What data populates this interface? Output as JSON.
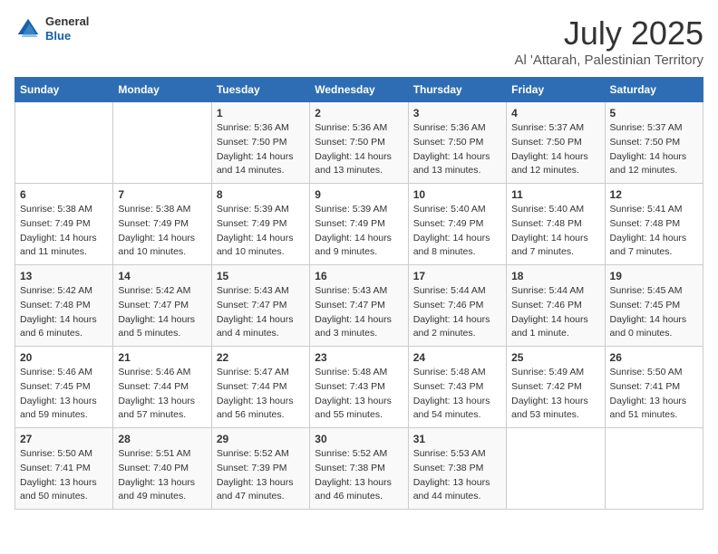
{
  "logo": {
    "general": "General",
    "blue": "Blue"
  },
  "title": "July 2025",
  "subtitle": "Al 'Attarah, Palestinian Territory",
  "weekdays": [
    "Sunday",
    "Monday",
    "Tuesday",
    "Wednesday",
    "Thursday",
    "Friday",
    "Saturday"
  ],
  "weeks": [
    [
      {
        "day": "",
        "info": ""
      },
      {
        "day": "",
        "info": ""
      },
      {
        "day": "1",
        "info": "Sunrise: 5:36 AM\nSunset: 7:50 PM\nDaylight: 14 hours\nand 14 minutes."
      },
      {
        "day": "2",
        "info": "Sunrise: 5:36 AM\nSunset: 7:50 PM\nDaylight: 14 hours\nand 13 minutes."
      },
      {
        "day": "3",
        "info": "Sunrise: 5:36 AM\nSunset: 7:50 PM\nDaylight: 14 hours\nand 13 minutes."
      },
      {
        "day": "4",
        "info": "Sunrise: 5:37 AM\nSunset: 7:50 PM\nDaylight: 14 hours\nand 12 minutes."
      },
      {
        "day": "5",
        "info": "Sunrise: 5:37 AM\nSunset: 7:50 PM\nDaylight: 14 hours\nand 12 minutes."
      }
    ],
    [
      {
        "day": "6",
        "info": "Sunrise: 5:38 AM\nSunset: 7:49 PM\nDaylight: 14 hours\nand 11 minutes."
      },
      {
        "day": "7",
        "info": "Sunrise: 5:38 AM\nSunset: 7:49 PM\nDaylight: 14 hours\nand 10 minutes."
      },
      {
        "day": "8",
        "info": "Sunrise: 5:39 AM\nSunset: 7:49 PM\nDaylight: 14 hours\nand 10 minutes."
      },
      {
        "day": "9",
        "info": "Sunrise: 5:39 AM\nSunset: 7:49 PM\nDaylight: 14 hours\nand 9 minutes."
      },
      {
        "day": "10",
        "info": "Sunrise: 5:40 AM\nSunset: 7:49 PM\nDaylight: 14 hours\nand 8 minutes."
      },
      {
        "day": "11",
        "info": "Sunrise: 5:40 AM\nSunset: 7:48 PM\nDaylight: 14 hours\nand 7 minutes."
      },
      {
        "day": "12",
        "info": "Sunrise: 5:41 AM\nSunset: 7:48 PM\nDaylight: 14 hours\nand 7 minutes."
      }
    ],
    [
      {
        "day": "13",
        "info": "Sunrise: 5:42 AM\nSunset: 7:48 PM\nDaylight: 14 hours\nand 6 minutes."
      },
      {
        "day": "14",
        "info": "Sunrise: 5:42 AM\nSunset: 7:47 PM\nDaylight: 14 hours\nand 5 minutes."
      },
      {
        "day": "15",
        "info": "Sunrise: 5:43 AM\nSunset: 7:47 PM\nDaylight: 14 hours\nand 4 minutes."
      },
      {
        "day": "16",
        "info": "Sunrise: 5:43 AM\nSunset: 7:47 PM\nDaylight: 14 hours\nand 3 minutes."
      },
      {
        "day": "17",
        "info": "Sunrise: 5:44 AM\nSunset: 7:46 PM\nDaylight: 14 hours\nand 2 minutes."
      },
      {
        "day": "18",
        "info": "Sunrise: 5:44 AM\nSunset: 7:46 PM\nDaylight: 14 hours\nand 1 minute."
      },
      {
        "day": "19",
        "info": "Sunrise: 5:45 AM\nSunset: 7:45 PM\nDaylight: 14 hours\nand 0 minutes."
      }
    ],
    [
      {
        "day": "20",
        "info": "Sunrise: 5:46 AM\nSunset: 7:45 PM\nDaylight: 13 hours\nand 59 minutes."
      },
      {
        "day": "21",
        "info": "Sunrise: 5:46 AM\nSunset: 7:44 PM\nDaylight: 13 hours\nand 57 minutes."
      },
      {
        "day": "22",
        "info": "Sunrise: 5:47 AM\nSunset: 7:44 PM\nDaylight: 13 hours\nand 56 minutes."
      },
      {
        "day": "23",
        "info": "Sunrise: 5:48 AM\nSunset: 7:43 PM\nDaylight: 13 hours\nand 55 minutes."
      },
      {
        "day": "24",
        "info": "Sunrise: 5:48 AM\nSunset: 7:43 PM\nDaylight: 13 hours\nand 54 minutes."
      },
      {
        "day": "25",
        "info": "Sunrise: 5:49 AM\nSunset: 7:42 PM\nDaylight: 13 hours\nand 53 minutes."
      },
      {
        "day": "26",
        "info": "Sunrise: 5:50 AM\nSunset: 7:41 PM\nDaylight: 13 hours\nand 51 minutes."
      }
    ],
    [
      {
        "day": "27",
        "info": "Sunrise: 5:50 AM\nSunset: 7:41 PM\nDaylight: 13 hours\nand 50 minutes."
      },
      {
        "day": "28",
        "info": "Sunrise: 5:51 AM\nSunset: 7:40 PM\nDaylight: 13 hours\nand 49 minutes."
      },
      {
        "day": "29",
        "info": "Sunrise: 5:52 AM\nSunset: 7:39 PM\nDaylight: 13 hours\nand 47 minutes."
      },
      {
        "day": "30",
        "info": "Sunrise: 5:52 AM\nSunset: 7:38 PM\nDaylight: 13 hours\nand 46 minutes."
      },
      {
        "day": "31",
        "info": "Sunrise: 5:53 AM\nSunset: 7:38 PM\nDaylight: 13 hours\nand 44 minutes."
      },
      {
        "day": "",
        "info": ""
      },
      {
        "day": "",
        "info": ""
      }
    ]
  ]
}
